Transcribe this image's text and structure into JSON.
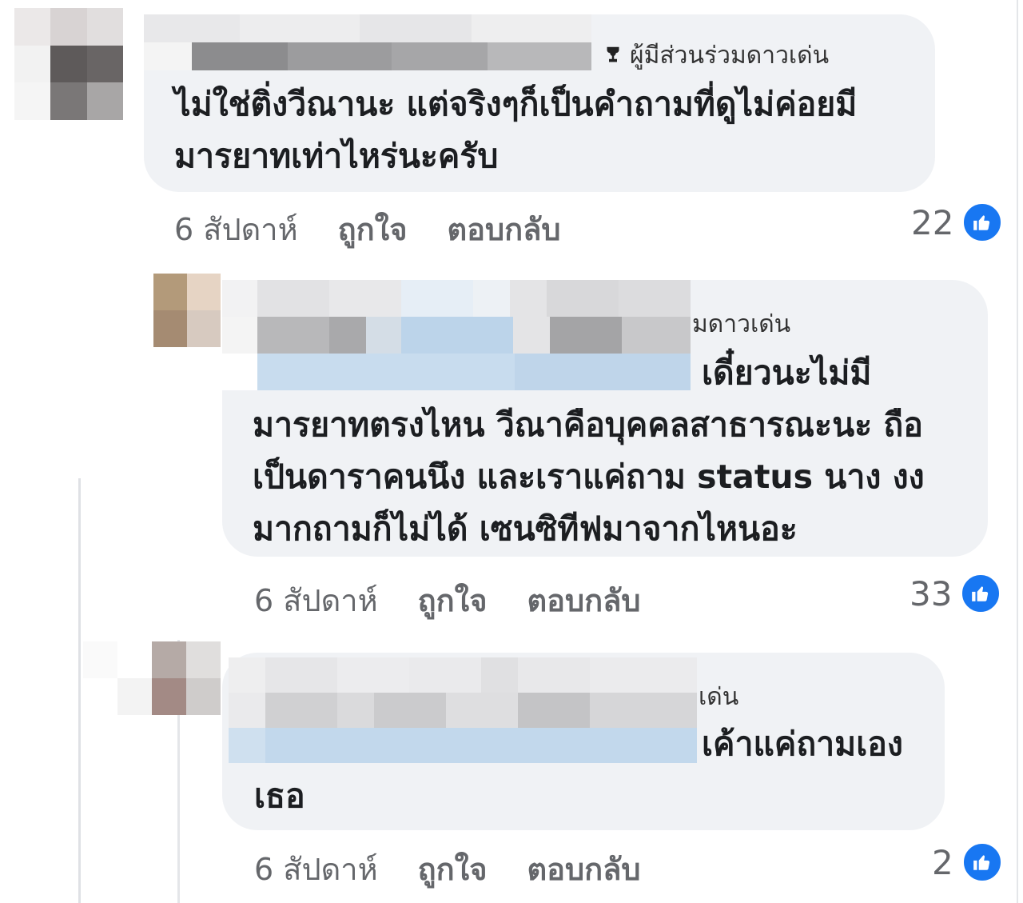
{
  "comments": [
    {
      "badge": "ผู้มีส่วนร่วมดาวเด่น",
      "lines": [
        "ไม่ใช่ติ่งวีณานะ แต่จริงๆก็เป็นคำถามที่ดูไม่ค่อยมี",
        "มารยาทเท่าไหร่นะครับ"
      ],
      "time": "6 สัปดาห์",
      "like_label": "ถูกใจ",
      "reply_label": "ตอบกลับ",
      "reactions": "22"
    },
    {
      "badge": "มดาวเด่น",
      "lines": [
        "เดี๋ยวนะไม่มี",
        "มารยาทตรงไหน วีณาคือบุคคลสาธารณะนะ ถือ",
        "เป็นดาราคนนึง และเราแค่ถาม status นาง งง",
        "มากถามก็ไม่ได้ เซนซิทีฟมาจากไหนอะ"
      ],
      "time": "6 สัปดาห์",
      "like_label": "ถูกใจ",
      "reply_label": "ตอบกลับ",
      "reactions": "33"
    },
    {
      "badge": "เด่น",
      "lines": [
        "เค้าแค่ถามเอง",
        "เธอ"
      ],
      "time": "6 สัปดาห์",
      "like_label": "ถูกใจ",
      "reply_label": "ตอบกลับ",
      "reactions": "2"
    }
  ],
  "icons": {
    "reaction": "like-thumb-icon",
    "badge": "trophy-icon"
  },
  "colors": {
    "bubble": "#f0f2f5",
    "like_blue": "#1877f2",
    "meta_gray": "#65676b"
  }
}
